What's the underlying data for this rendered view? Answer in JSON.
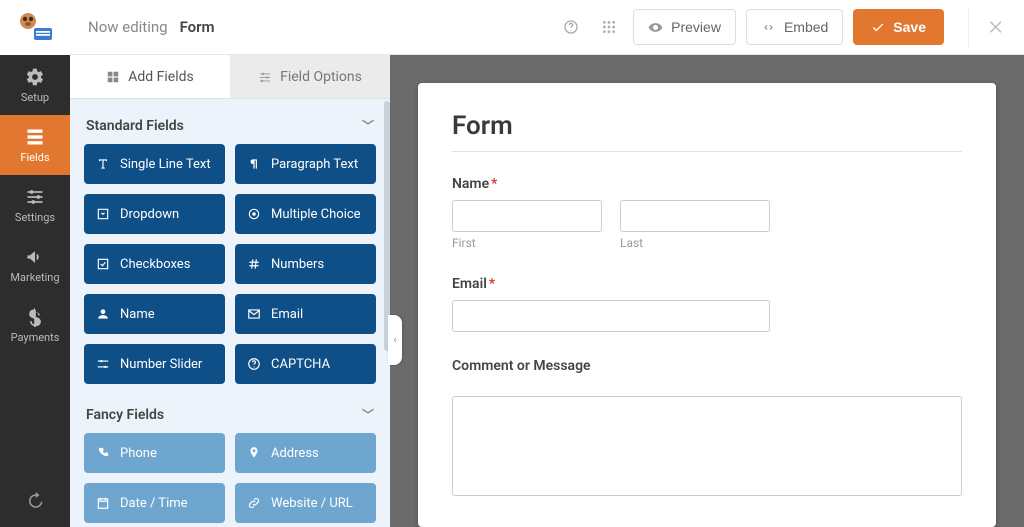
{
  "leftnav": {
    "items": [
      {
        "id": "setup",
        "label": "Setup"
      },
      {
        "id": "fields",
        "label": "Fields"
      },
      {
        "id": "settings",
        "label": "Settings"
      },
      {
        "id": "marketing",
        "label": "Marketing"
      },
      {
        "id": "payments",
        "label": "Payments"
      }
    ],
    "active": "fields"
  },
  "topbar": {
    "now_editing": "Now editing",
    "form_name": "Form",
    "preview": "Preview",
    "embed": "Embed",
    "save": "Save"
  },
  "tabs": {
    "add_fields": "Add Fields",
    "field_options": "Field Options"
  },
  "sections": {
    "standard": {
      "title": "Standard Fields",
      "fields": [
        {
          "id": "single-line-text",
          "label": "Single Line Text",
          "icon": "text"
        },
        {
          "id": "paragraph-text",
          "label": "Paragraph Text",
          "icon": "paragraph"
        },
        {
          "id": "dropdown",
          "label": "Dropdown",
          "icon": "caret-sq"
        },
        {
          "id": "multiple-choice",
          "label": "Multiple Choice",
          "icon": "circle-dot"
        },
        {
          "id": "checkboxes",
          "label": "Checkboxes",
          "icon": "check-sq"
        },
        {
          "id": "numbers",
          "label": "Numbers",
          "icon": "hash"
        },
        {
          "id": "name",
          "label": "Name",
          "icon": "user"
        },
        {
          "id": "email",
          "label": "Email",
          "icon": "envelope"
        },
        {
          "id": "number-slider",
          "label": "Number Slider",
          "icon": "sliders"
        },
        {
          "id": "captcha",
          "label": "CAPTCHA",
          "icon": "question"
        }
      ]
    },
    "fancy": {
      "title": "Fancy Fields",
      "fields": [
        {
          "id": "phone",
          "label": "Phone",
          "icon": "phone"
        },
        {
          "id": "address",
          "label": "Address",
          "icon": "pin"
        },
        {
          "id": "date-time",
          "label": "Date / Time",
          "icon": "calendar"
        },
        {
          "id": "website-url",
          "label": "Website / URL",
          "icon": "link"
        }
      ]
    }
  },
  "canvas": {
    "title": "Form",
    "name_label": "Name",
    "first_sub": "First",
    "last_sub": "Last",
    "email_label": "Email",
    "comment_label": "Comment or Message",
    "required_marker": "*"
  }
}
